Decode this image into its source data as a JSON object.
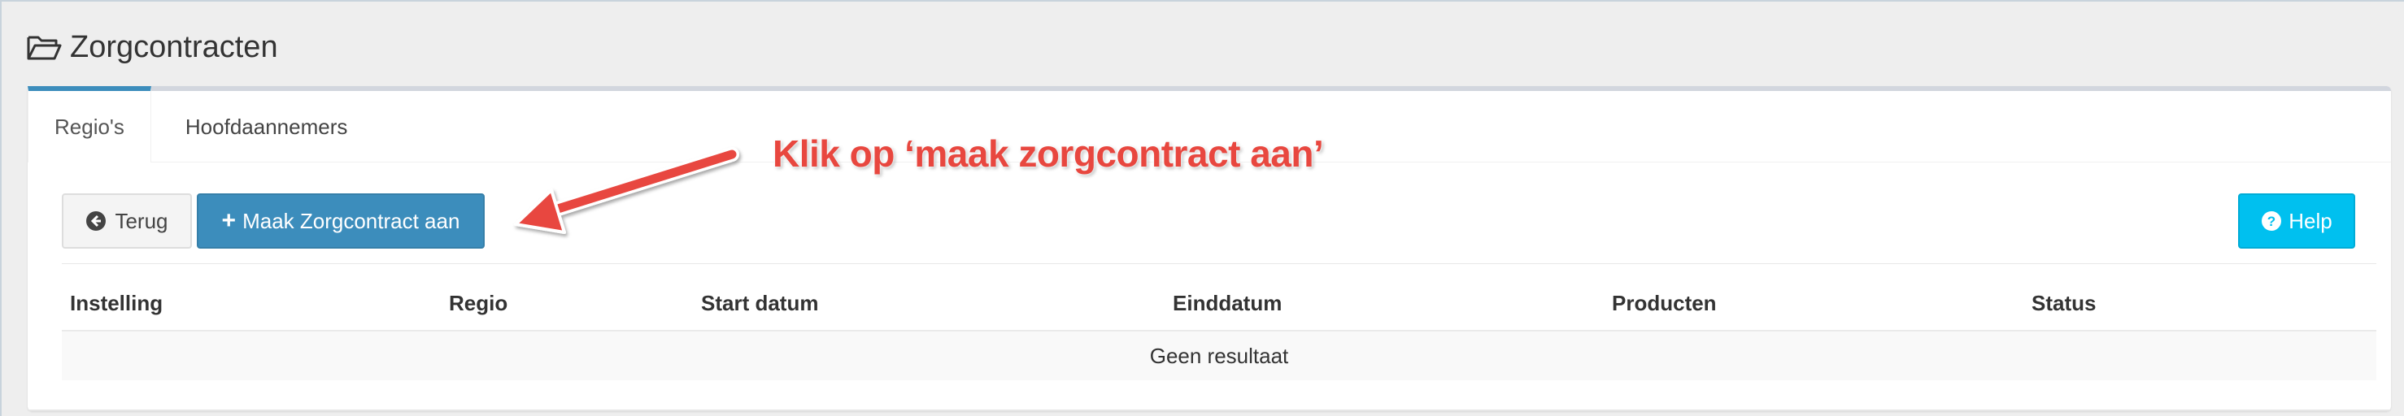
{
  "header": {
    "title": "Zorgcontracten",
    "icon": "folder-open-icon"
  },
  "tabs": [
    {
      "label": "Regio's",
      "active": true
    },
    {
      "label": "Hoofdaannemers",
      "active": false
    }
  ],
  "toolbar": {
    "back_label": "Terug",
    "create_label": "Maak Zorgcontract aan",
    "help_label": "Help"
  },
  "table": {
    "columns": [
      "Instelling",
      "Regio",
      "Start datum",
      "Einddatum",
      "Producten",
      "Status"
    ],
    "empty_message": "Geen resultaat"
  },
  "annotation": {
    "text": "Klik op ‘maak zorgcontract aan’",
    "color": "#e8473f"
  },
  "colors": {
    "primary": "#3c8dbc",
    "info": "#00c0ef",
    "default_bg": "#f4f4f4"
  }
}
